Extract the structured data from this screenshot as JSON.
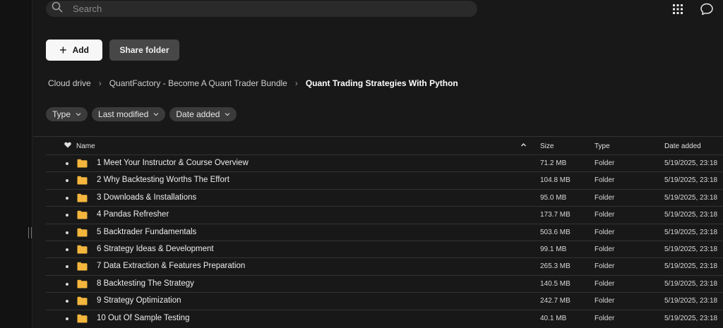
{
  "search": {
    "placeholder": "Search"
  },
  "toolbar": {
    "add_label": "Add",
    "share_label": "Share folder"
  },
  "breadcrumb": [
    {
      "label": "Cloud drive"
    },
    {
      "label": "QuantFactory - Become A Quant Trader Bundle"
    },
    {
      "label": "Quant Trading Strategies With Python"
    }
  ],
  "filters": [
    {
      "label": "Type"
    },
    {
      "label": "Last modified"
    },
    {
      "label": "Date added"
    }
  ],
  "table": {
    "headers": {
      "name": "Name",
      "size": "Size",
      "type": "Type",
      "date_added": "Date added"
    },
    "rows": [
      {
        "name": "1 Meet Your Instructor & Course Overview",
        "size": "71.2 MB",
        "type": "Folder",
        "date_added": "5/19/2025, 23:18"
      },
      {
        "name": "2 Why Backtesting Worths The Effort",
        "size": "104.8 MB",
        "type": "Folder",
        "date_added": "5/19/2025, 23:18"
      },
      {
        "name": "3 Downloads & Installations",
        "size": "95.0 MB",
        "type": "Folder",
        "date_added": "5/19/2025, 23:18"
      },
      {
        "name": "4 Pandas Refresher",
        "size": "173.7 MB",
        "type": "Folder",
        "date_added": "5/19/2025, 23:18"
      },
      {
        "name": "5 Backtrader Fundamentals",
        "size": "503.6 MB",
        "type": "Folder",
        "date_added": "5/19/2025, 23:18"
      },
      {
        "name": "6 Strategy Ideas & Development",
        "size": "99.1 MB",
        "type": "Folder",
        "date_added": "5/19/2025, 23:18"
      },
      {
        "name": "7 Data Extraction & Features Preparation",
        "size": "265.3 MB",
        "type": "Folder",
        "date_added": "5/19/2025, 23:18"
      },
      {
        "name": "8 Backtesting The Strategy",
        "size": "140.5 MB",
        "type": "Folder",
        "date_added": "5/19/2025, 23:18"
      },
      {
        "name": "9 Strategy Optimization",
        "size": "242.7 MB",
        "type": "Folder",
        "date_added": "5/19/2025, 23:18"
      },
      {
        "name": "10 Out Of Sample Testing",
        "size": "40.1 MB",
        "type": "Folder",
        "date_added": "5/19/2025, 23:18"
      }
    ]
  },
  "colors": {
    "background": "#181818",
    "folder": "#f4b63d",
    "add_button": "#f7f7f7",
    "share_button": "#474747"
  },
  "icons": [
    "search-icon",
    "apps-grid-icon",
    "chat-icon",
    "plus-icon",
    "chevron-down-icon",
    "heart-icon",
    "sort-ascending-icon",
    "folder-icon"
  ]
}
